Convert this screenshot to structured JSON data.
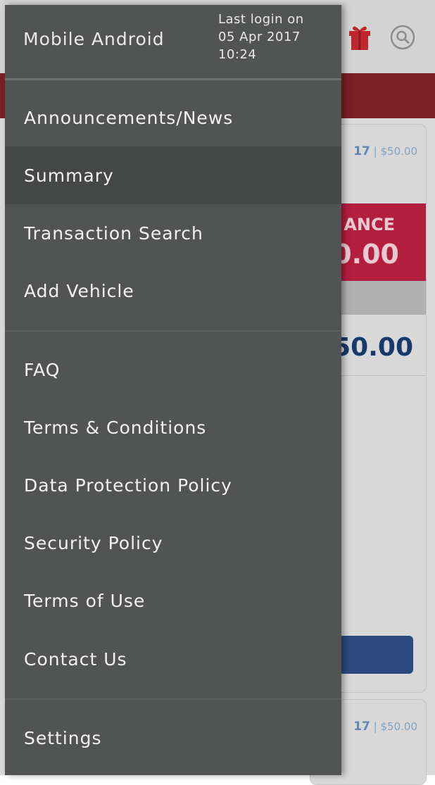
{
  "drawer": {
    "user_name": "Mobile Android",
    "last_login": {
      "line1": "Last login on",
      "line2": "05 Apr 2017",
      "line3": "10:24"
    },
    "groups": [
      [
        {
          "label": "Announcements/News"
        },
        {
          "label": "Summary",
          "active": true
        },
        {
          "label": "Transaction Search"
        },
        {
          "label": "Add Vehicle"
        }
      ],
      [
        {
          "label": "FAQ"
        },
        {
          "label": "Terms & Conditions"
        },
        {
          "label": "Data Protection Policy"
        },
        {
          "label": "Security Policy"
        },
        {
          "label": "Terms of Use"
        },
        {
          "label": "Contact Us"
        }
      ],
      [
        {
          "label": "Settings"
        }
      ]
    ]
  },
  "background": {
    "cards": [
      {
        "date_fragment": "17",
        "amount_fragment": "$50.00"
      },
      {
        "date_fragment": "17",
        "amount_fragment": "$50.00"
      }
    ],
    "balance_label_fragment": "ANCE",
    "balance_value_fragment": "0.00",
    "amount_value_fragment": "50.00",
    "date_separator": "|"
  },
  "icons": {
    "gift": "gift-icon",
    "search": "search-icon"
  },
  "colors": {
    "drawer_bg": "#525453",
    "active_item_bg": "#454746",
    "banner": "#7a1f24",
    "balance_box": "#b41e3f",
    "amount_text": "#173a6a",
    "button": "#2c4a80",
    "gift": "#c0272d"
  }
}
